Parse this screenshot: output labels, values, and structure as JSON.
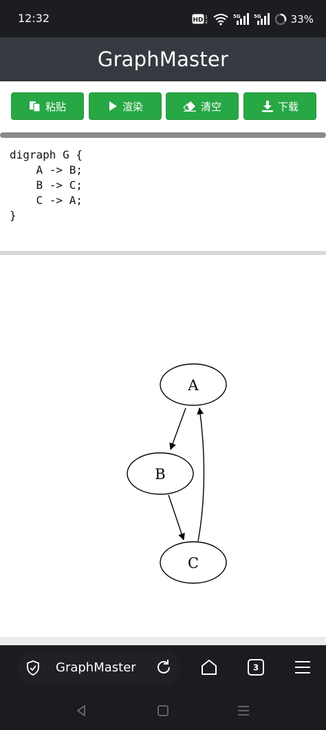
{
  "status_bar": {
    "time": "12:32",
    "hd_label": "HD",
    "network_5g_1": "5G",
    "network_5g_2": "5G",
    "battery": "33%"
  },
  "header": {
    "title": "GraphMaster"
  },
  "toolbar": {
    "buttons": [
      {
        "label": "粘贴",
        "icon": "paste-icon"
      },
      {
        "label": "渲染",
        "icon": "play-icon"
      },
      {
        "label": "清空",
        "icon": "eraser-icon"
      },
      {
        "label": "下载",
        "icon": "download-icon"
      }
    ]
  },
  "editor": {
    "lines": [
      "digraph G {",
      "    A -> B;",
      "    B -> C;",
      "    C -> A;",
      "}"
    ]
  },
  "graph": {
    "nodes": [
      {
        "label": "A"
      },
      {
        "label": "B"
      },
      {
        "label": "C"
      }
    ],
    "edges": [
      {
        "from": "A",
        "to": "B"
      },
      {
        "from": "B",
        "to": "C"
      },
      {
        "from": "C",
        "to": "A"
      }
    ]
  },
  "browser": {
    "tab_title": "GraphMaster",
    "tab_count": "3",
    "icons": [
      "shield-check-icon",
      "reload-icon",
      "home-icon",
      "tabs-icon",
      "menu-icon"
    ]
  },
  "colors": {
    "status_bg": "#1c1d21",
    "header_bg": "#343a40",
    "button_green": "#28a745",
    "browser_bg": "#1b1c20"
  }
}
